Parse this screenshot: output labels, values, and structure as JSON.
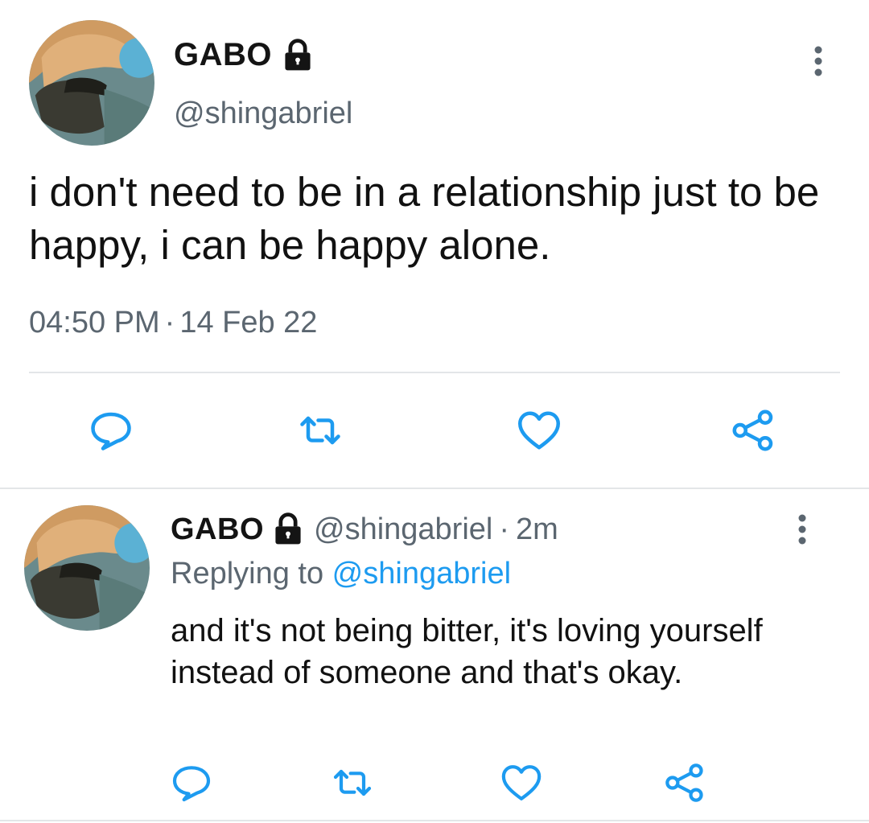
{
  "tweet": {
    "display_name": "GABO",
    "handle": "@shingabriel",
    "text": "i don't need to be in a relationship just to be happy, i can be happy alone.",
    "time": "04:50 PM",
    "separator": "·",
    "date": "14 Feb 22",
    "icons": {
      "lock": "lock-icon",
      "more": "more-vertical-icon",
      "reply": "reply-icon",
      "retweet": "retweet-icon",
      "like": "heart-icon",
      "share": "share-icon"
    }
  },
  "reply_tweet": {
    "display_name": "GABO",
    "handle": "@shingabriel",
    "separator": "·",
    "age": "2m",
    "replying_prefix": "Replying to ",
    "replying_handle": "@shingabriel",
    "text": "and it's not being bitter, it's loving yourself instead of someone and that's okay."
  },
  "colors": {
    "text": "#111111",
    "muted": "#5b6670",
    "link": "#1d9bf0",
    "icon": "#1d9bf0",
    "divider": "#e3e6e8"
  }
}
